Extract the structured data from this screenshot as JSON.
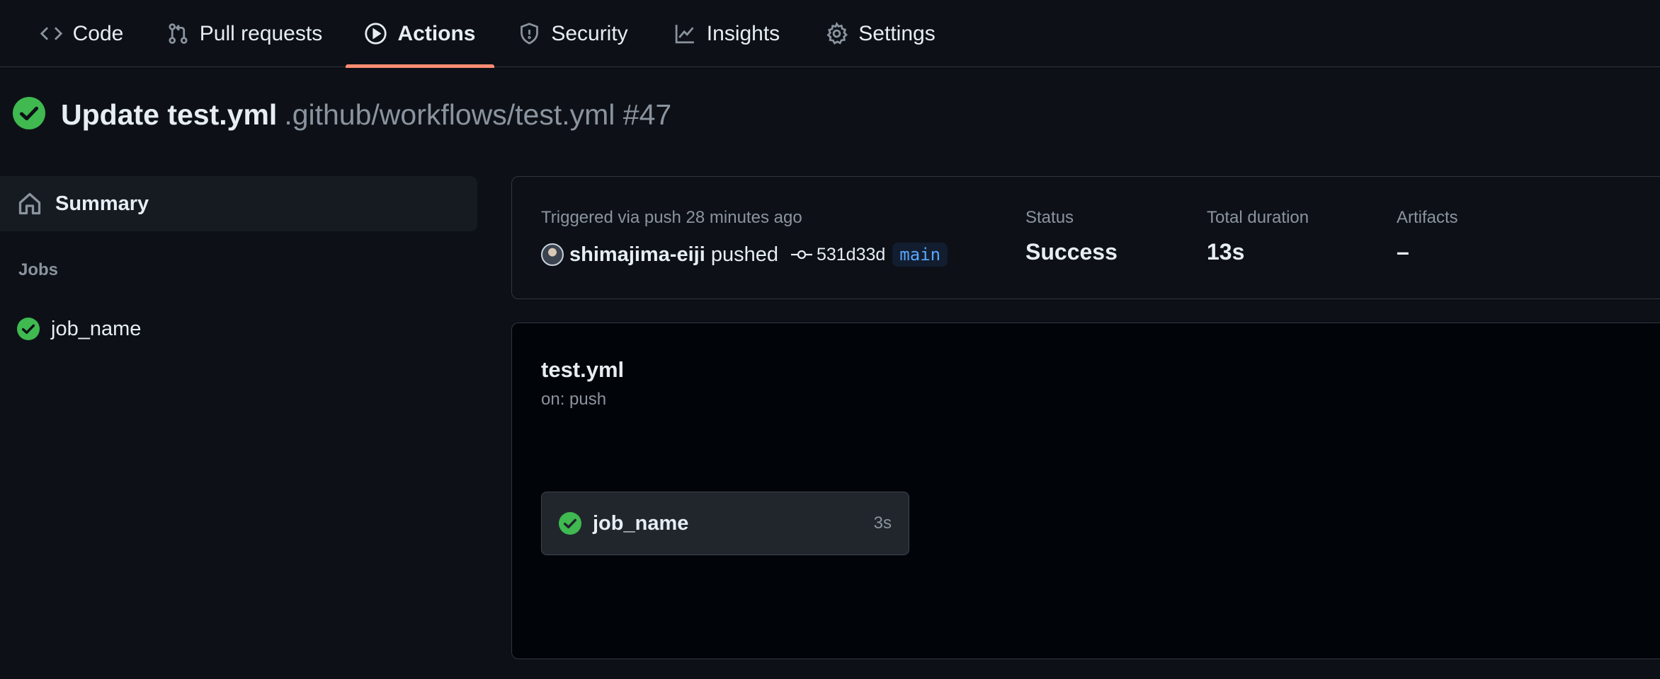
{
  "nav": {
    "tabs": [
      {
        "label": "Code",
        "icon": "code-icon"
      },
      {
        "label": "Pull requests",
        "icon": "git-pull-request-icon"
      },
      {
        "label": "Actions",
        "icon": "play-icon",
        "active": true
      },
      {
        "label": "Security",
        "icon": "shield-icon"
      },
      {
        "label": "Insights",
        "icon": "graph-icon"
      },
      {
        "label": "Settings",
        "icon": "gear-icon"
      }
    ],
    "active_underline_color": "#fd8c73"
  },
  "run": {
    "title": "Update test.yml",
    "path": ".github/workflows/test.yml #47",
    "status_icon": "check-circle-icon",
    "status_color": "#3fb950"
  },
  "sidebar": {
    "summary_label": "Summary",
    "summary_icon": "home-icon",
    "jobs_heading": "Jobs",
    "jobs": [
      {
        "name": "job_name",
        "icon": "check-circle-icon"
      }
    ]
  },
  "summary": {
    "triggered": "Triggered via push 28 minutes ago",
    "actor": "shimajima-eiji",
    "action": "pushed",
    "commit_icon": "git-commit-icon",
    "sha": "531d33d",
    "branch": "main",
    "status_label": "Status",
    "status_value": "Success",
    "duration_label": "Total duration",
    "duration_value": "13s",
    "artifacts_label": "Artifacts",
    "artifacts_value": "–"
  },
  "workflow": {
    "name": "test.yml",
    "trigger": "on: push",
    "jobs": [
      {
        "name": "job_name",
        "duration": "3s",
        "icon": "check-circle-icon"
      }
    ]
  }
}
